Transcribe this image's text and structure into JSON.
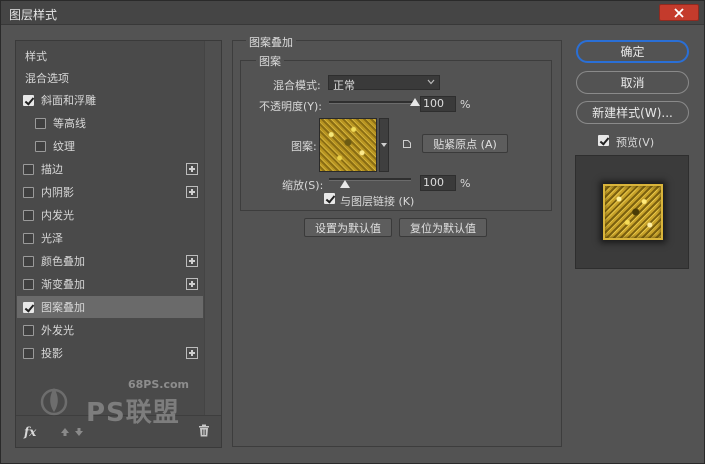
{
  "window": {
    "title": "图层样式"
  },
  "sidebar": {
    "header": "样式",
    "blend_options": "混合选项",
    "items": [
      {
        "label": "斜面和浮雕",
        "checked": true,
        "plus": false,
        "indent": 0
      },
      {
        "label": "等高线",
        "checked": false,
        "plus": false,
        "indent": 1
      },
      {
        "label": "纹理",
        "checked": false,
        "plus": false,
        "indent": 1
      },
      {
        "label": "描边",
        "checked": false,
        "plus": true,
        "indent": 0
      },
      {
        "label": "内阴影",
        "checked": false,
        "plus": true,
        "indent": 0
      },
      {
        "label": "内发光",
        "checked": false,
        "plus": false,
        "indent": 0
      },
      {
        "label": "光泽",
        "checked": false,
        "plus": false,
        "indent": 0
      },
      {
        "label": "颜色叠加",
        "checked": false,
        "plus": true,
        "indent": 0
      },
      {
        "label": "渐变叠加",
        "checked": false,
        "plus": true,
        "indent": 0
      },
      {
        "label": "图案叠加",
        "checked": true,
        "plus": false,
        "indent": 0,
        "selected": true
      },
      {
        "label": "外发光",
        "checked": false,
        "plus": false,
        "indent": 0
      },
      {
        "label": "投影",
        "checked": false,
        "plus": true,
        "indent": 0
      }
    ],
    "fx_label": "fx"
  },
  "panel": {
    "section_title": "图案叠加",
    "group_title": "图案",
    "blend_mode_label": "混合模式:",
    "blend_mode_value": "正常",
    "opacity_label": "不透明度(Y):",
    "opacity_value": "100",
    "opacity_level": 1.0,
    "pattern_label": "图案:",
    "snap_button": "贴紧原点 (A)",
    "scale_label": "缩放(S):",
    "scale_value": "100",
    "scale_level": 0.2,
    "percent": "%",
    "link_label": "与图层链接 (K)",
    "link_checked": true,
    "set_default": "设置为默认值",
    "reset_default": "复位为默认值"
  },
  "right": {
    "ok": "确定",
    "cancel": "取消",
    "new_style": "新建样式(W)...",
    "preview_label": "预览(V)",
    "preview_checked": true
  },
  "watermark": {
    "site": "68PS.com",
    "text": "PS联盟"
  },
  "colors": {
    "accent": "#2a6fd6",
    "close": "#c43b2c",
    "gold": "#c9a22a"
  }
}
